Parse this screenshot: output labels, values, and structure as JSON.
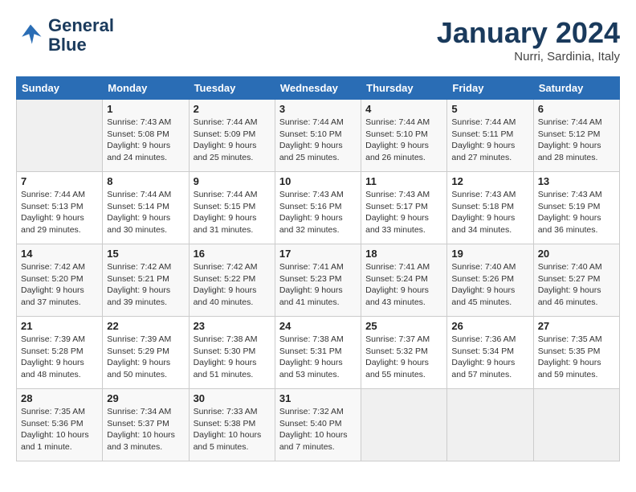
{
  "header": {
    "logo_line1": "General",
    "logo_line2": "Blue",
    "month": "January 2024",
    "location": "Nurri, Sardinia, Italy"
  },
  "weekdays": [
    "Sunday",
    "Monday",
    "Tuesday",
    "Wednesday",
    "Thursday",
    "Friday",
    "Saturday"
  ],
  "weeks": [
    [
      {
        "day": "",
        "sunrise": "",
        "sunset": "",
        "daylight": ""
      },
      {
        "day": "1",
        "sunrise": "Sunrise: 7:43 AM",
        "sunset": "Sunset: 5:08 PM",
        "daylight": "Daylight: 9 hours and 24 minutes."
      },
      {
        "day": "2",
        "sunrise": "Sunrise: 7:44 AM",
        "sunset": "Sunset: 5:09 PM",
        "daylight": "Daylight: 9 hours and 25 minutes."
      },
      {
        "day": "3",
        "sunrise": "Sunrise: 7:44 AM",
        "sunset": "Sunset: 5:10 PM",
        "daylight": "Daylight: 9 hours and 25 minutes."
      },
      {
        "day": "4",
        "sunrise": "Sunrise: 7:44 AM",
        "sunset": "Sunset: 5:10 PM",
        "daylight": "Daylight: 9 hours and 26 minutes."
      },
      {
        "day": "5",
        "sunrise": "Sunrise: 7:44 AM",
        "sunset": "Sunset: 5:11 PM",
        "daylight": "Daylight: 9 hours and 27 minutes."
      },
      {
        "day": "6",
        "sunrise": "Sunrise: 7:44 AM",
        "sunset": "Sunset: 5:12 PM",
        "daylight": "Daylight: 9 hours and 28 minutes."
      }
    ],
    [
      {
        "day": "7",
        "sunrise": "Sunrise: 7:44 AM",
        "sunset": "Sunset: 5:13 PM",
        "daylight": "Daylight: 9 hours and 29 minutes."
      },
      {
        "day": "8",
        "sunrise": "Sunrise: 7:44 AM",
        "sunset": "Sunset: 5:14 PM",
        "daylight": "Daylight: 9 hours and 30 minutes."
      },
      {
        "day": "9",
        "sunrise": "Sunrise: 7:44 AM",
        "sunset": "Sunset: 5:15 PM",
        "daylight": "Daylight: 9 hours and 31 minutes."
      },
      {
        "day": "10",
        "sunrise": "Sunrise: 7:43 AM",
        "sunset": "Sunset: 5:16 PM",
        "daylight": "Daylight: 9 hours and 32 minutes."
      },
      {
        "day": "11",
        "sunrise": "Sunrise: 7:43 AM",
        "sunset": "Sunset: 5:17 PM",
        "daylight": "Daylight: 9 hours and 33 minutes."
      },
      {
        "day": "12",
        "sunrise": "Sunrise: 7:43 AM",
        "sunset": "Sunset: 5:18 PM",
        "daylight": "Daylight: 9 hours and 34 minutes."
      },
      {
        "day": "13",
        "sunrise": "Sunrise: 7:43 AM",
        "sunset": "Sunset: 5:19 PM",
        "daylight": "Daylight: 9 hours and 36 minutes."
      }
    ],
    [
      {
        "day": "14",
        "sunrise": "Sunrise: 7:42 AM",
        "sunset": "Sunset: 5:20 PM",
        "daylight": "Daylight: 9 hours and 37 minutes."
      },
      {
        "day": "15",
        "sunrise": "Sunrise: 7:42 AM",
        "sunset": "Sunset: 5:21 PM",
        "daylight": "Daylight: 9 hours and 39 minutes."
      },
      {
        "day": "16",
        "sunrise": "Sunrise: 7:42 AM",
        "sunset": "Sunset: 5:22 PM",
        "daylight": "Daylight: 9 hours and 40 minutes."
      },
      {
        "day": "17",
        "sunrise": "Sunrise: 7:41 AM",
        "sunset": "Sunset: 5:23 PM",
        "daylight": "Daylight: 9 hours and 41 minutes."
      },
      {
        "day": "18",
        "sunrise": "Sunrise: 7:41 AM",
        "sunset": "Sunset: 5:24 PM",
        "daylight": "Daylight: 9 hours and 43 minutes."
      },
      {
        "day": "19",
        "sunrise": "Sunrise: 7:40 AM",
        "sunset": "Sunset: 5:26 PM",
        "daylight": "Daylight: 9 hours and 45 minutes."
      },
      {
        "day": "20",
        "sunrise": "Sunrise: 7:40 AM",
        "sunset": "Sunset: 5:27 PM",
        "daylight": "Daylight: 9 hours and 46 minutes."
      }
    ],
    [
      {
        "day": "21",
        "sunrise": "Sunrise: 7:39 AM",
        "sunset": "Sunset: 5:28 PM",
        "daylight": "Daylight: 9 hours and 48 minutes."
      },
      {
        "day": "22",
        "sunrise": "Sunrise: 7:39 AM",
        "sunset": "Sunset: 5:29 PM",
        "daylight": "Daylight: 9 hours and 50 minutes."
      },
      {
        "day": "23",
        "sunrise": "Sunrise: 7:38 AM",
        "sunset": "Sunset: 5:30 PM",
        "daylight": "Daylight: 9 hours and 51 minutes."
      },
      {
        "day": "24",
        "sunrise": "Sunrise: 7:38 AM",
        "sunset": "Sunset: 5:31 PM",
        "daylight": "Daylight: 9 hours and 53 minutes."
      },
      {
        "day": "25",
        "sunrise": "Sunrise: 7:37 AM",
        "sunset": "Sunset: 5:32 PM",
        "daylight": "Daylight: 9 hours and 55 minutes."
      },
      {
        "day": "26",
        "sunrise": "Sunrise: 7:36 AM",
        "sunset": "Sunset: 5:34 PM",
        "daylight": "Daylight: 9 hours and 57 minutes."
      },
      {
        "day": "27",
        "sunrise": "Sunrise: 7:35 AM",
        "sunset": "Sunset: 5:35 PM",
        "daylight": "Daylight: 9 hours and 59 minutes."
      }
    ],
    [
      {
        "day": "28",
        "sunrise": "Sunrise: 7:35 AM",
        "sunset": "Sunset: 5:36 PM",
        "daylight": "Daylight: 10 hours and 1 minute."
      },
      {
        "day": "29",
        "sunrise": "Sunrise: 7:34 AM",
        "sunset": "Sunset: 5:37 PM",
        "daylight": "Daylight: 10 hours and 3 minutes."
      },
      {
        "day": "30",
        "sunrise": "Sunrise: 7:33 AM",
        "sunset": "Sunset: 5:38 PM",
        "daylight": "Daylight: 10 hours and 5 minutes."
      },
      {
        "day": "31",
        "sunrise": "Sunrise: 7:32 AM",
        "sunset": "Sunset: 5:40 PM",
        "daylight": "Daylight: 10 hours and 7 minutes."
      },
      {
        "day": "",
        "sunrise": "",
        "sunset": "",
        "daylight": ""
      },
      {
        "day": "",
        "sunrise": "",
        "sunset": "",
        "daylight": ""
      },
      {
        "day": "",
        "sunrise": "",
        "sunset": "",
        "daylight": ""
      }
    ]
  ]
}
